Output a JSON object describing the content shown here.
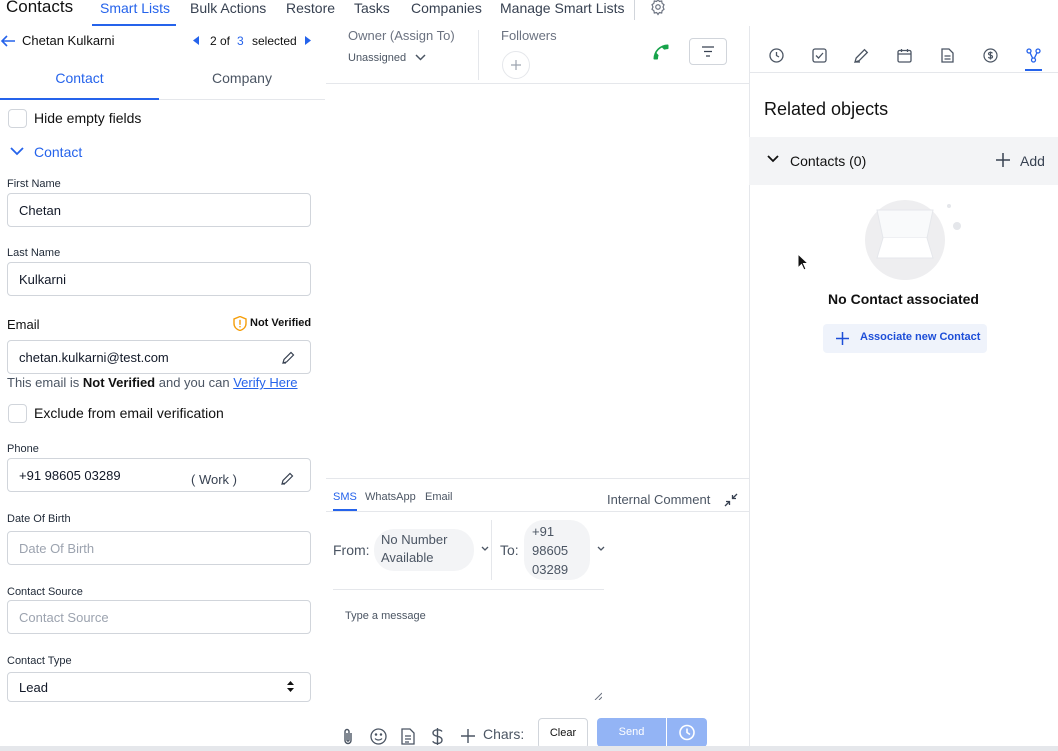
{
  "nav": {
    "title": "Contacts",
    "items": [
      "Smart Lists",
      "Bulk Actions",
      "Restore",
      "Tasks",
      "Companies",
      "Manage Smart Lists"
    ]
  },
  "record": {
    "name": "Chetan Kulkarni",
    "position": "2 of",
    "total": "3",
    "selected_label": "selected"
  },
  "tabs": {
    "contact": "Contact",
    "company": "Company"
  },
  "hide_empty": "Hide empty fields",
  "section_title": "Contact",
  "fields": {
    "first_name_label": "First Name",
    "first_name": "Chetan",
    "last_name_label": "Last Name",
    "last_name": "Kulkarni",
    "email_label": "Email",
    "email_status": "Not Verified",
    "email": "chetan.kulkarni@test.com",
    "email_note_prefix": "This email is",
    "email_note_bold": "Not Verified",
    "email_note_mid": "and you can",
    "email_note_link": "Verify Here",
    "exclude_label": "Exclude from email verification",
    "phone_label": "Phone",
    "phone": "+91 98605 03289",
    "phone_type": "( Work )",
    "dob_label": "Date Of Birth",
    "dob_placeholder": "Date Of Birth",
    "source_label": "Contact Source",
    "source_placeholder": "Contact Source",
    "type_label": "Contact Type",
    "type_value": "Lead"
  },
  "owner": {
    "label": "Owner (Assign To)",
    "value": "Unassigned"
  },
  "followers": {
    "label": "Followers"
  },
  "composer": {
    "tabs": [
      "SMS",
      "WhatsApp",
      "Email"
    ],
    "internal_comment": "Internal Comment",
    "from_label": "From:",
    "from_value": "No Number Available",
    "to_label": "To:",
    "to_value": "+91 98605 03289",
    "message_placeholder": "Type a message",
    "chars_label": "Chars:",
    "clear": "Clear",
    "send": "Send"
  },
  "related": {
    "title": "Related objects",
    "contacts_header": "Contacts (0)",
    "add": "Add",
    "empty": "No Contact associated",
    "associate": "Associate new Contact"
  },
  "colors": {
    "accent": "#2563eb",
    "send_disabled": "#93b4f5",
    "phone_green": "#16a34a",
    "warning": "#f59e0b"
  }
}
